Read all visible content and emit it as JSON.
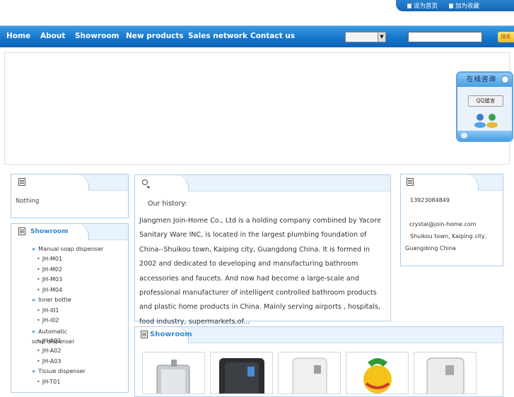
{
  "top_links": {
    "set_home": "设为首页",
    "add_favorite": "加为收藏"
  },
  "nav": {
    "items": [
      "Home",
      "About",
      "Showroom",
      "New products",
      "Sales network",
      "Contact us"
    ],
    "search_button": "搜索"
  },
  "consult": {
    "title": "在线咨询",
    "qq_button": "QQ留言"
  },
  "news_box": {
    "text": "Nothing"
  },
  "showroom_box": {
    "title": "Showroom",
    "categories": [
      {
        "name": "Manual soap dispenser",
        "items": [
          "JH-M01",
          "JH-M02",
          "JH-M03",
          "JH-M04"
        ]
      },
      {
        "name": "Inner bottle",
        "items": [
          "JH-I01",
          "JH-I02"
        ]
      },
      {
        "name": "Automatic soap dispenser",
        "items": [
          "JH-A01",
          "JH-A02",
          "JH-A03"
        ]
      },
      {
        "name": "Tissue dispenser",
        "items": [
          "JH-T01"
        ]
      }
    ]
  },
  "about_box": {
    "heading": "Our history:",
    "body": "Jiangmen Join-Home Co., Ltd is a holding company combined by Yacore Sanitary Ware INC, is located in the largest plumbing foundation of China--Shuikou town, Kaiping city, Guangdong China. It is formed in 2002 and dedicated to developing and manufacturing bathroom accessories and faucets. And now had become a large-scale and professional manufacturer of intelligent controlled bathroom products and plastic home products in China. Mainly serving airports , hospitals, food industry, supermarkets,of..."
  },
  "contact_box": {
    "phone": "13923084849",
    "email": "crystal@join-home.com",
    "address_line1": "Shuikou town, Kaiping city,",
    "address_line2": "Guangdong China"
  },
  "showroom_products": {
    "title": "Showroom",
    "count": 5
  }
}
